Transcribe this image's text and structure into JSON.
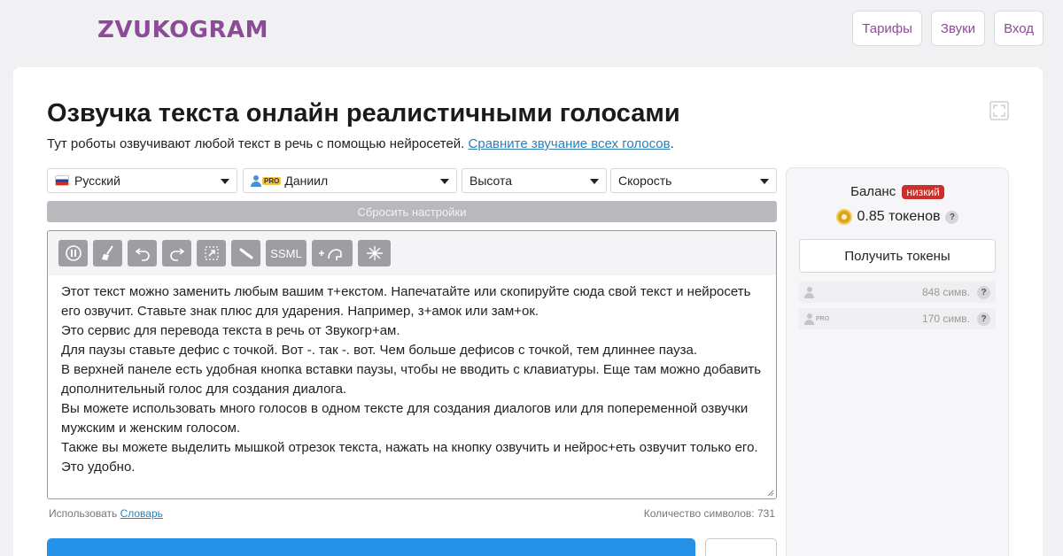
{
  "header": {
    "logo_text": "ZVUKOGRAM",
    "nav": [
      "Тарифы",
      "Звуки",
      "Вход"
    ]
  },
  "main": {
    "title": "Озвучка текста онлайн реалистичными голосами",
    "subtitle": "Тут роботы озвучивают любой текст в речь с помощью нейросетей.",
    "subtitle_link": "Сравните звучание всех голосов",
    "subtitle_end": "."
  },
  "selects": {
    "language": "Русский",
    "pro_badge": "PRO",
    "voice": "Даниил",
    "pitch": "Высота",
    "speed": "Скорость"
  },
  "reset_label": "Сбросить настройки",
  "toolbar": {
    "ssml_label": "SSML",
    "icons": [
      "pause-icon",
      "broom-icon",
      "undo-icon",
      "redo-icon",
      "cursor-icon",
      "pen-icon",
      "add-voice-icon",
      "magic-icon"
    ]
  },
  "editor": {
    "lines": [
      "Этот текст можно заменить любым вашим т+екстом. Напечатайте или скопируйте сюда свой текст и нейросеть",
      "его озвучит. Ставьте знак плюс для ударения. Например, з+амок или зам+ок.",
      "Это сервис для перевода текста в речь от Звукогр+ам.",
      "Для паузы ставьте дефис с точкой. Вот -. так -. вот. Чем больше дефисов с точкой, тем длиннее пауза.",
      "В верхней панеле есть удобная кнопка вставки паузы, чтобы не вводить с клавиатуры. Еще там можно добавить",
      "дополнительный голос для создания диалога.",
      "Вы можете использовать много голосов в одном тексте для создания диалогов или для попеременной озвучки",
      "мужским и женским голосом.",
      "Также вы можете выделить мышкой отрезок текста, нажать на кнопку озвучить и нейрос+еть озвучит только его.",
      "Это удобно."
    ]
  },
  "footer": {
    "use_label": "Использовать",
    "dictionary_link": "Словарь",
    "char_count": "Количество символов: 731"
  },
  "balance": {
    "title": "Баланс",
    "status_badge": "низкий",
    "tokens": "0.85 токенов",
    "help": "?",
    "get_tokens": "Получить токены",
    "limits": [
      {
        "value": "848 симв.",
        "pro": ""
      },
      {
        "value": "170 симв.",
        "pro": "PRO"
      }
    ]
  }
}
